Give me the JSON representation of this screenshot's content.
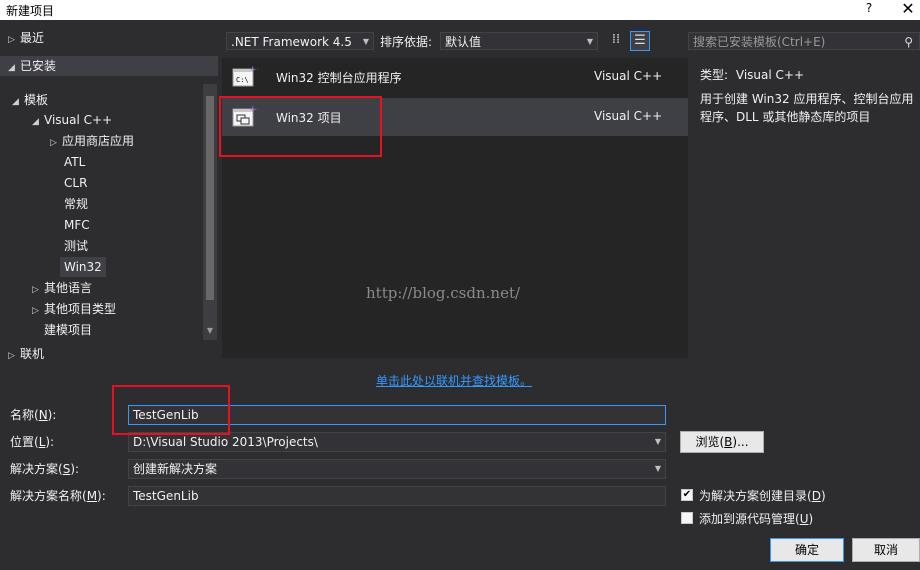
{
  "window": {
    "title": "新建项目",
    "help": "?",
    "close": "✕"
  },
  "tree": {
    "recent": "最近",
    "installed": "已安装",
    "templates": "模板",
    "visual_cpp": "Visual C++",
    "store_apps": "应用商店应用",
    "atl": "ATL",
    "clr": "CLR",
    "general": "常规",
    "mfc": "MFC",
    "test": "测试",
    "win32": "Win32",
    "other_languages": "其他语言",
    "other_project_types": "其他项目类型",
    "modeling_projects": "建模项目",
    "online": "联机"
  },
  "toolbar": {
    "framework": ".NET Framework 4.5",
    "sort_label": "排序依据:",
    "sort_value": "默认值",
    "search_placeholder": "搜索已安装模板(Ctrl+E)"
  },
  "templates": [
    {
      "name": "Win32 控制台应用程序",
      "lang": "Visual C++",
      "icon_text": "C:\\"
    },
    {
      "name": "Win32 项目",
      "lang": "Visual C++",
      "icon_text": ""
    }
  ],
  "watermark": "http://blog.csdn.net/",
  "online_link": "单击此处以联机并查找模板。",
  "description": {
    "type_label": "类型:",
    "type_value": "Visual C++",
    "text": "用于创建 Win32 应用程序、控制台应用程序、DLL 或其他静态库的项目"
  },
  "form": {
    "name_label": "名称(",
    "name_key": "N",
    "name_tail": "):",
    "name_value": "TestGenLib",
    "location_label": "位置(",
    "location_key": "L",
    "location_tail": "):",
    "location_value": "D:\\Visual Studio 2013\\Projects\\",
    "browse": "浏览(",
    "browse_key": "B",
    "browse_tail": ")...",
    "solution_label": "解决方案(",
    "solution_key": "S",
    "solution_tail": "):",
    "solution_value": "创建新解决方案",
    "solution_name_label": "解决方案名称(",
    "solution_name_key": "M",
    "solution_name_tail": "):",
    "solution_name_value": "TestGenLib",
    "create_dir_label": "为解决方案创建目录(",
    "create_dir_key": "D",
    "create_dir_tail": ")",
    "create_dir_checked": true,
    "add_source_label": "添加到源代码管理(",
    "add_source_key": "U",
    "add_source_tail": ")",
    "add_source_checked": false,
    "ok": "确定",
    "cancel": "取消"
  },
  "colors": {
    "accent": "#3399ff",
    "highlight": "#e81123",
    "link": "#3399ff"
  }
}
